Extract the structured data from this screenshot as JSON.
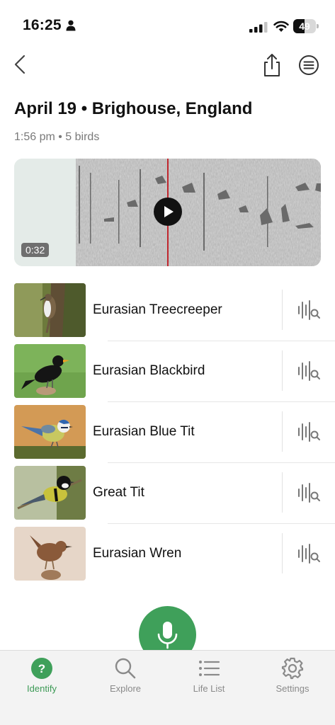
{
  "status_bar": {
    "time": "16:25",
    "battery": "49",
    "battery_level": 0.49
  },
  "header": {
    "title": "April 19 • Brighouse, England",
    "subtitle": "1:56 pm • 5 birds"
  },
  "recording": {
    "duration": "0:32"
  },
  "species": [
    {
      "name": "Eurasian Treecreeper",
      "thumb_icon": "treecreeper-photo"
    },
    {
      "name": "Eurasian Blackbird",
      "thumb_icon": "blackbird-photo"
    },
    {
      "name": "Eurasian Blue Tit",
      "thumb_icon": "blue-tit-photo"
    },
    {
      "name": "Great Tit",
      "thumb_icon": "great-tit-photo"
    },
    {
      "name": "Eurasian Wren",
      "thumb_icon": "wren-photo"
    }
  ],
  "tabs": [
    {
      "label": "Identify",
      "icon": "question-icon",
      "active": true
    },
    {
      "label": "Explore",
      "icon": "search-icon",
      "active": false
    },
    {
      "label": "Life List",
      "icon": "list-icon",
      "active": false
    },
    {
      "label": "Settings",
      "icon": "gear-icon",
      "active": false
    }
  ],
  "colors": {
    "accent": "#3fa05a",
    "playhead": "#c0262d"
  }
}
